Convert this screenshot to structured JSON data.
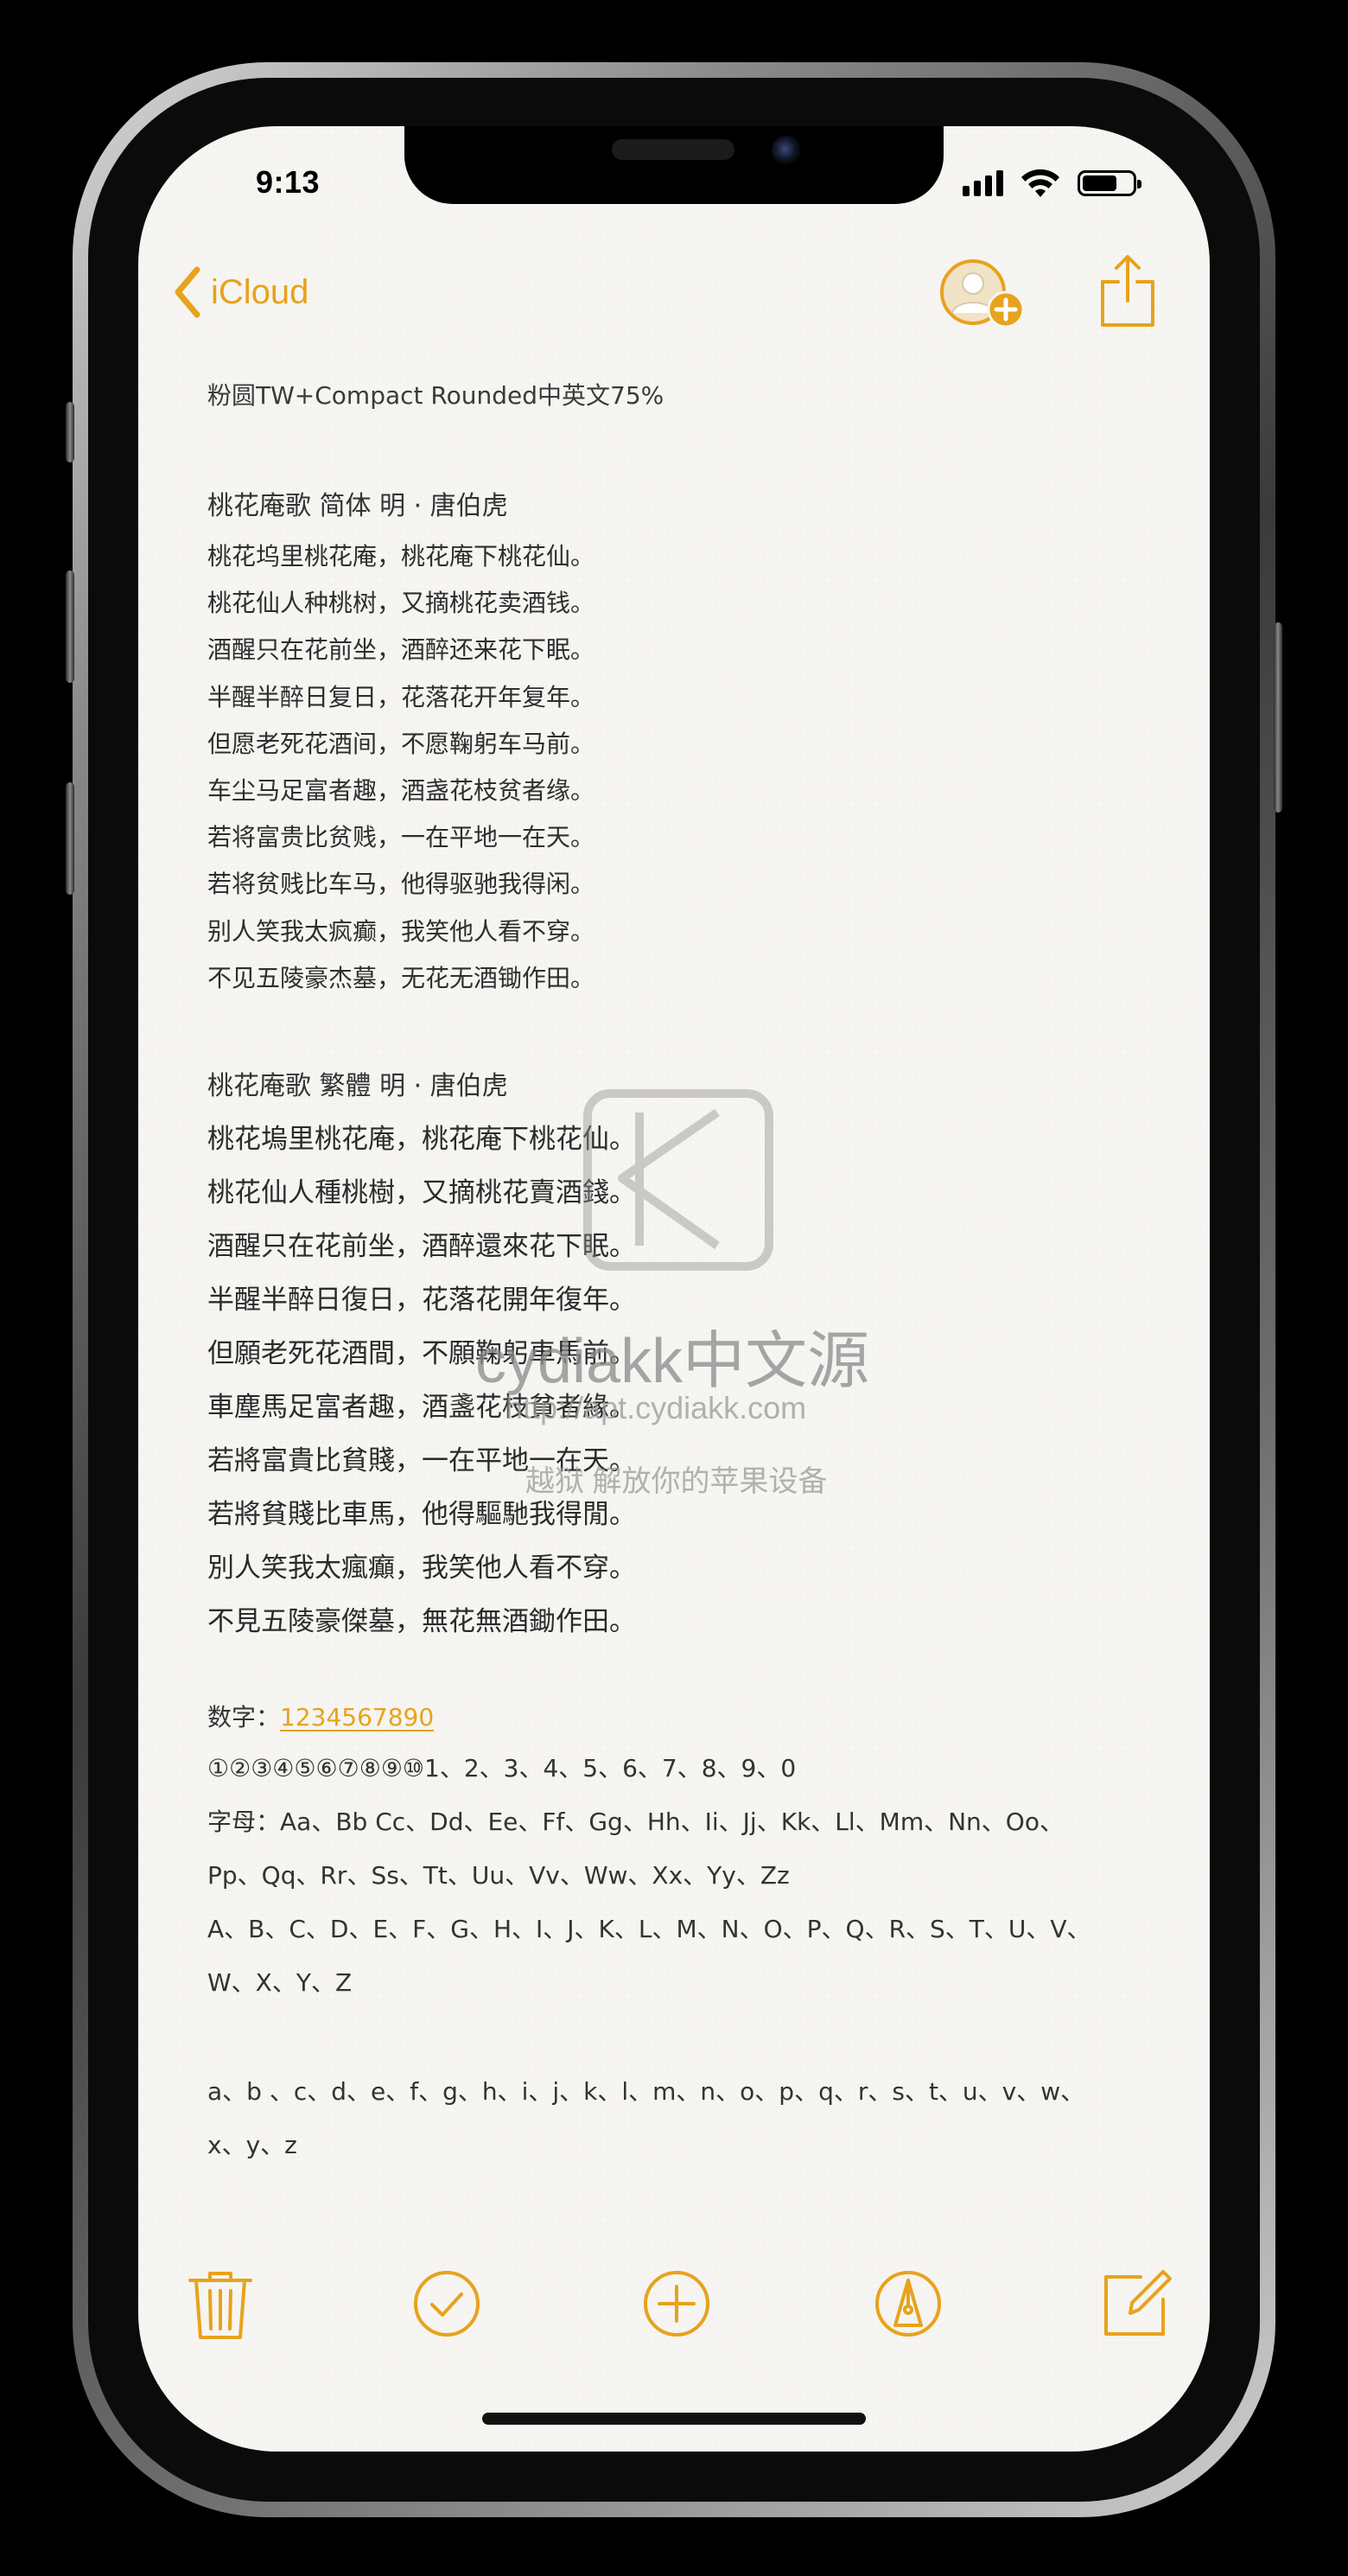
{
  "status_bar": {
    "time": "9:13",
    "battery_level": 0.7
  },
  "nav": {
    "back_label": "iCloud",
    "back_icon": "chevron-left-icon",
    "add_person_icon": "person-add-icon",
    "share_icon": "share-icon"
  },
  "note": {
    "font_title": "粉圆TW+Compact Rounded中英文75%",
    "poem_simplified": {
      "title": "桃花庵歌  简体   明 · 唐伯虎",
      "lines": [
        "桃花坞里桃花庵，桃花庵下桃花仙。",
        "桃花仙人种桃树，又摘桃花卖酒钱。",
        "酒醒只在花前坐，酒醉还来花下眠。",
        "半醒半醉日复日，花落花开年复年。",
        "但愿老死花酒间，不愿鞠躬车马前。",
        "车尘马足富者趣，酒盏花枝贫者缘。",
        "若将富贵比贫贱，一在平地一在天。",
        "若将贫贱比车马，他得驱驰我得闲。",
        "别人笑我太疯癫，我笑他人看不穿。",
        "不见五陵豪杰墓，无花无酒锄作田。"
      ]
    },
    "poem_traditional": {
      "title": "桃花庵歌  繁體     明 · 唐伯虎",
      "lines": [
        "桃花塢里桃花庵，桃花庵下桃花仙。",
        "桃花仙人種桃樹，又摘桃花賣酒錢。",
        "酒醒只在花前坐，酒醉還來花下眠。",
        "半醒半醉日復日，花落花開年復年。",
        "但願老死花酒間，不願鞠躬車馬前。",
        "車塵馬足富者趣，酒盞花枝貧者緣。",
        "若將富貴比貧賤，一在平地一在天。",
        "若將貧賤比車馬，他得驅馳我得閒。",
        "別人笑我太瘋癲，我笑他人看不穿。",
        "不見五陵豪傑墓，無花無酒鋤作田。"
      ]
    },
    "numbers_label": "数字：",
    "numbers_link": "1234567890",
    "circled_numbers": "①②③④⑤⑥⑦⑧⑨⑩1、2、3、4、5、6、7、8、9、0",
    "letters_line1": "字母：Aa、Bb Cc、Dd、Ee、Ff、Gg、Hh、Ii、Jj、Kk、Ll、Mm、Nn、Oo、",
    "letters_line2": "Pp、Qq、Rr、Ss、Tt、Uu、Vv、Ww、Xx、Yy、Zz",
    "upper_line1": "A、B、C、D、E、F、G、H、I、J、K、L、M、N、O、P、Q、R、S、T、U、V、",
    "upper_line2": "W、X、Y、Z",
    "lower_line1": "a、b 、c、d、e、f、g、h、i、j、k、l、m、n、o、p、q、r、s、t、u、v、w、",
    "lower_line2": "x、y、z"
  },
  "watermark": {
    "brand": "cydiakk中文源",
    "url": "http://apt.cydiakk.com",
    "slogan": "越狱 解放你的苹果设备"
  },
  "toolbar": {
    "delete_icon": "trash-icon",
    "checklist_icon": "checkmark-circle-icon",
    "add_icon": "plus-circle-icon",
    "markup_icon": "pen-tip-circle-icon",
    "compose_icon": "compose-icon"
  },
  "colors": {
    "accent": "#e8a21c",
    "paper": "#f6f5f2",
    "text": "#2f2f2f"
  }
}
